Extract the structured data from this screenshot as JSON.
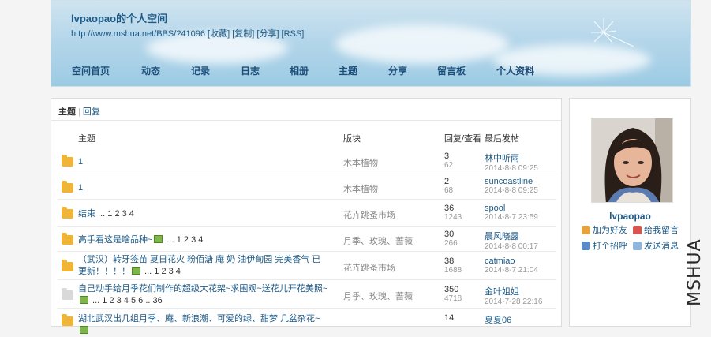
{
  "header": {
    "title": "lvpaopao的个人空间",
    "url_line": "http://www.mshua.net/BBS/?41096 [收藏] [复制] [分享] [RSS]"
  },
  "nav": [
    "空间首页",
    "动态",
    "记录",
    "日志",
    "相册",
    "主题",
    "分享",
    "留言板",
    "个人资料"
  ],
  "tabs": {
    "active": "主题",
    "other": "回复"
  },
  "columns": {
    "topic": "主题",
    "board": "版块",
    "counts": "回复/查看",
    "last": "最后发帖"
  },
  "rows": [
    {
      "icon": "hot",
      "title": "1",
      "pages": "",
      "board": "木本植物",
      "replies": "3",
      "views": "62",
      "user": "林中听雨",
      "time": "2014-8-8 09:25"
    },
    {
      "icon": "hot",
      "title": "1",
      "pages": "",
      "board": "木本植物",
      "replies": "2",
      "views": "68",
      "user": "suncoastline",
      "time": "2014-8-8 09:25"
    },
    {
      "icon": "hot",
      "title": "结束",
      "pages": " ... 1 2 3 4",
      "board": "花卉跳蚤市场",
      "replies": "36",
      "views": "1243",
      "user": "spool",
      "time": "2014-8-7 23:59"
    },
    {
      "icon": "hot",
      "title": "高手看这是啥品种~",
      "pages": " ... 1 2 3 4",
      "has_image": true,
      "board": "月季、玫瑰、蔷薇",
      "replies": "30",
      "views": "266",
      "user": "晨风晓露",
      "time": "2014-8-8 00:17"
    },
    {
      "icon": "hot",
      "title": "（武汉）转牙签苗 夏日花火 粉佰溏 庵 奶 油伊甸园 完美香气 已更新！！！！",
      "pages": " ... 1 2 3 4",
      "has_image": true,
      "board": "花卉跳蚤市场",
      "replies": "38",
      "views": "1688",
      "user": "catmiao",
      "time": "2014-8-7 21:04"
    },
    {
      "icon": "cold",
      "title": "自己动手给月季花们制作的超级大花架~求围观~送花儿开花美照~",
      "pages": " ... 1 2 3 4 5 6 .. 36",
      "has_image": true,
      "board": "月季、玫瑰、蔷薇",
      "replies": "350",
      "views": "4718",
      "user": "金叶姐姐",
      "time": "2014-7-28 22:16"
    },
    {
      "icon": "hot",
      "title": "湖北武汉出几组月季、庵、新浪潮、可爱的绿、甜梦 几盆杂花~",
      "pages": "",
      "has_image": true,
      "board": "",
      "replies": "14",
      "views": "",
      "user": "夏夏06",
      "time": ""
    }
  ],
  "profile": {
    "name": "lvpaopao",
    "actions": [
      "加为好友",
      "给我留言",
      "打个招呼",
      "发送消息"
    ]
  },
  "watermark": "MSHUA",
  "colors": {
    "link": "#1d5a86",
    "header_sky": "#b5d6ea",
    "folder": "#f0b437"
  }
}
